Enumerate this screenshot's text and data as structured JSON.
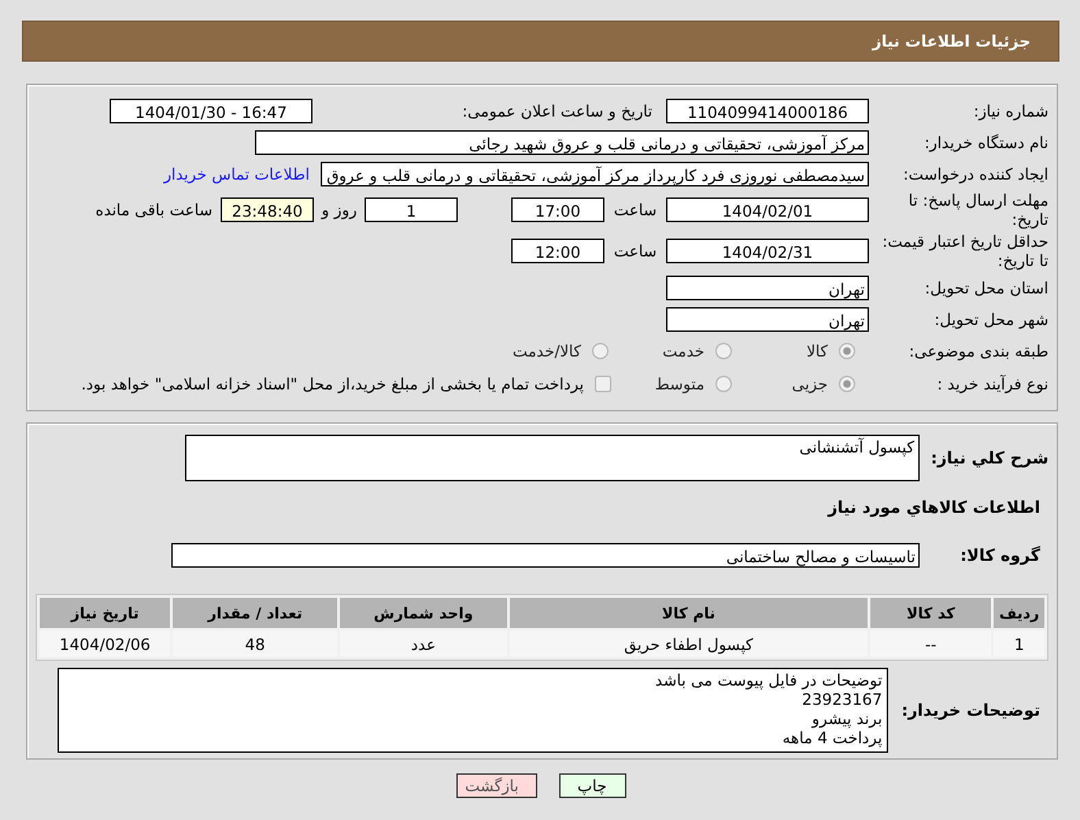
{
  "header": {
    "title": "جزئیات اطلاعات نیاز"
  },
  "need_info": {
    "need_number": {
      "label": "شماره نیاز:",
      "value": "1104099414000186"
    },
    "announce": {
      "label": "تاریخ و ساعت اعلان عمومی:",
      "value": "1404/01/30 - 16:47"
    },
    "buyer_org": {
      "label": "نام دستگاه خریدار:",
      "value": "مرکز آموزشی، تحقیقاتی و درمانی قلب و عروق شهید رجائی"
    },
    "creator": {
      "label": "ایجاد کننده درخواست:",
      "value": "سیدمصطفی نوروزی فرد کارپرداز مرکز آموزشی، تحقیقاتی و درمانی قلب و عروق",
      "link": "اطلاعات تماس خریدار"
    },
    "response_deadline": {
      "label": "مهلت ارسال پاسخ: تا تاریخ:",
      "date": "1404/02/01",
      "time_label": "ساعت",
      "time": "17:00",
      "days": "1",
      "days_label": "روز و",
      "remaining": "23:48:40",
      "remaining_label": "ساعت باقی مانده"
    },
    "price_validity": {
      "label": "حداقل تاریخ اعتبار قیمت: تا تاریخ:",
      "date": "1404/02/31",
      "time_label": "ساعت",
      "time": "12:00"
    },
    "province": {
      "label": "استان محل تحویل:",
      "value": "تهران"
    },
    "city": {
      "label": "شهر محل تحویل:",
      "value": "تهران"
    },
    "category": {
      "label": "طبقه بندی موضوعی:",
      "options": [
        {
          "label": "کالا",
          "selected": true
        },
        {
          "label": "خدمت",
          "selected": false
        },
        {
          "label": "کالا/خدمت",
          "selected": false
        }
      ]
    },
    "process": {
      "label": "نوع فرآیند خرید :",
      "options": [
        {
          "label": "جزیی",
          "selected": true
        },
        {
          "label": "متوسط",
          "selected": false
        }
      ],
      "checkbox": {
        "label": "پرداخت تمام یا بخشی از مبلغ خرید،از محل \"اسناد خزانه اسلامی\" خواهد بود.",
        "checked": false
      }
    }
  },
  "description": {
    "label": "شرح کلي نياز:",
    "value": "کپسول آتشنشانی"
  },
  "goods_heading": "اطلاعات کالاهاي مورد نياز",
  "goods_group": {
    "label": "گروه کالا:",
    "value": "تاسیسات و مصالح ساختمانی"
  },
  "table": {
    "columns": [
      "ردیف",
      "کد کالا",
      "نام کالا",
      "واحد شمارش",
      "تعداد / مقدار",
      "تاریخ نیاز"
    ],
    "rows": [
      [
        "1",
        "--",
        "کپسول اطفاء حریق",
        "عدد",
        "48",
        "1404/02/06"
      ]
    ]
  },
  "buyer_notes": {
    "label": "توضیحات خریدار:",
    "value": "توضیحات در فایل پیوست می باشد\n23923167\nبرند پیشرو\nپرداخت 4 ماهه"
  },
  "buttons": [
    {
      "label": "چاپ",
      "kind": "print"
    },
    {
      "label": "بازگشت",
      "kind": "back"
    }
  ]
}
